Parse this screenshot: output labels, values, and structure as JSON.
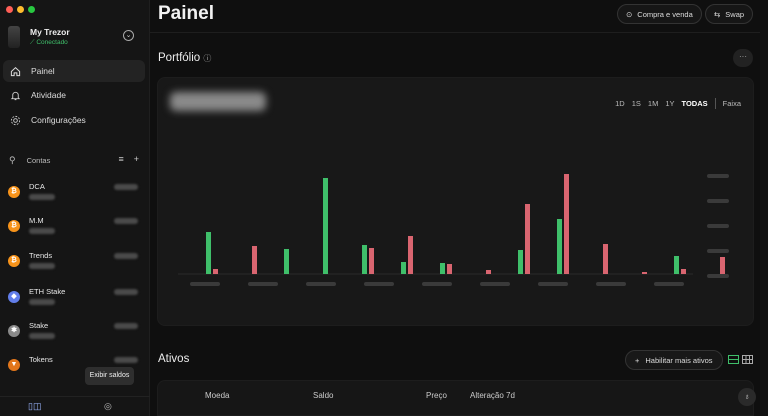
{
  "window": {
    "controls": [
      "close",
      "minimize",
      "maximize"
    ],
    "colors": {
      "close": "#ff5f57",
      "minimize": "#febc2e",
      "maximize": "#28c840"
    }
  },
  "device": {
    "name": "My Trezor",
    "status": "Conectado"
  },
  "nav": [
    {
      "label": "Painel",
      "icon": "home-icon",
      "active": true
    },
    {
      "label": "Atividade",
      "icon": "bell-icon",
      "active": false
    },
    {
      "label": "Configurações",
      "icon": "gear-icon",
      "active": false
    }
  ],
  "accounts": {
    "header": "Contas",
    "items": [
      {
        "name": "DCA",
        "coin": "bitcoin-icon",
        "color": "#f7931a"
      },
      {
        "name": "M.M",
        "coin": "bitcoin-icon",
        "color": "#f7931a"
      },
      {
        "name": "Trends",
        "coin": "bitcoin-icon",
        "color": "#f7931a"
      },
      {
        "name": "ETH Stake",
        "coin": "ethereum-icon",
        "color": "#627eea"
      },
      {
        "name": "Stake",
        "coin": "cardano-icon",
        "color": "#8a8a8a"
      },
      {
        "name": "Tokens",
        "coin": "metamask-icon",
        "color": "#e2761b"
      }
    ]
  },
  "tooltip": "Exibir saldos",
  "main": {
    "title": "Painel",
    "buy_sell": "Compra e venda",
    "swap": "Swap",
    "portfolio_title": "Portfólio",
    "ranges": [
      "1D",
      "1S",
      "1M",
      "1Y",
      "TODAS"
    ],
    "active_range": "TODAS",
    "faixa": "Faixa",
    "assets_title": "Ativos",
    "enable_more": "Habilitar mais ativos",
    "table_headers": {
      "coin": "Moeda",
      "balance": "Saldo",
      "price": "Preço",
      "change": "Alteração 7d"
    }
  },
  "chart_data": {
    "type": "bar",
    "note_hidden_values": true,
    "series": [
      {
        "name": "",
        "color": "#3fbf6a",
        "values": [
          0.42,
          0,
          0.25,
          0.96,
          0.29,
          0.12,
          0.11,
          0,
          0.24,
          0.55,
          0,
          0,
          0.18,
          0
        ]
      },
      {
        "name": "",
        "color": "#d96570",
        "values": [
          0.05,
          0.28,
          0,
          0,
          0.26,
          0.38,
          0.1,
          0.04,
          0.7,
          1.0,
          0.3,
          0.02,
          0.05,
          0.17
        ]
      }
    ]
  }
}
